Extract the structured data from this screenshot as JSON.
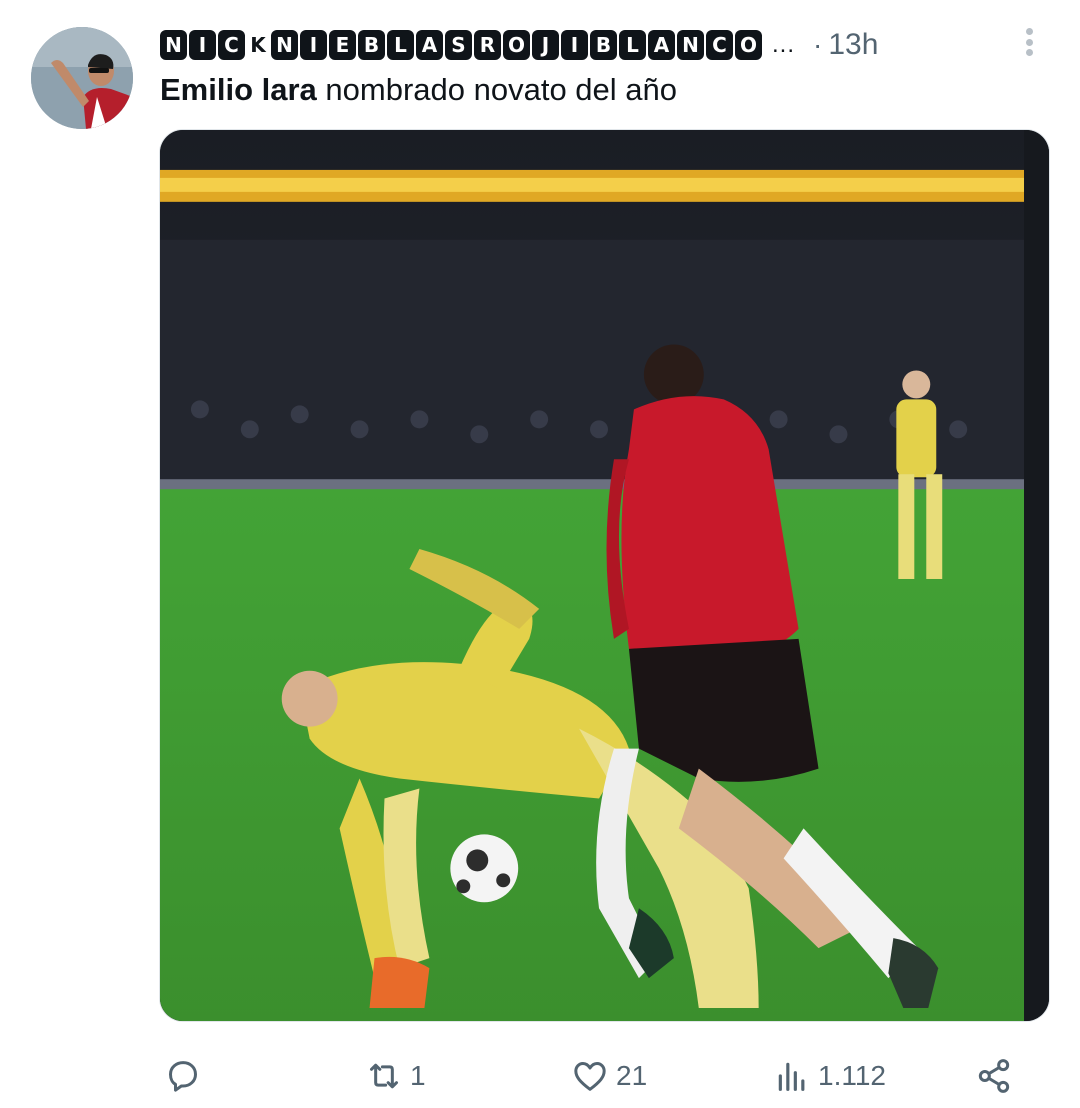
{
  "tweet": {
    "display_name_letters": [
      "N",
      "I",
      "C",
      "K",
      "N",
      "I",
      "E",
      "B",
      "L",
      "A",
      "S",
      "R",
      "O",
      "J",
      "I",
      "B",
      "L",
      "A",
      "N",
      "C",
      "O"
    ],
    "name_truncation": "...",
    "separator": "·",
    "timestamp": "13h",
    "text_bold": "Emilio lara",
    "text_rest": " nombrado novato del año"
  },
  "actions": {
    "reply_count": "",
    "retweet_count": "1",
    "like_count": "21",
    "views_count": "1.112"
  },
  "icons": {
    "more": "more-vertical-icon",
    "reply": "reply-icon",
    "retweet": "retweet-icon",
    "like": "heart-icon",
    "views": "views-icon",
    "share": "share-icon"
  },
  "colors": {
    "text_primary": "#0f1419",
    "text_secondary": "#536471",
    "pitch_green": "#3f9a2f",
    "home_kit_red": "#c8192b",
    "away_kit_yellow": "#e3d14a"
  }
}
